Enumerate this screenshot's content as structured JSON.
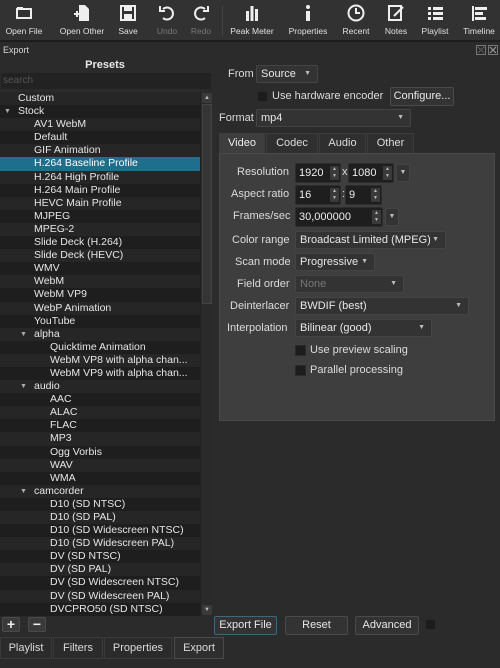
{
  "toolbar": {
    "buttons": [
      {
        "label": "Open File",
        "icon": "folder-icon"
      },
      {
        "label": "Open Other",
        "icon": "open-other-icon"
      },
      {
        "label": "Save",
        "icon": "save-icon"
      },
      {
        "label": "Undo",
        "icon": "undo-icon",
        "disabled": true
      },
      {
        "label": "Redo",
        "icon": "redo-icon",
        "disabled": true
      },
      {
        "label": "Peak Meter",
        "icon": "peak-meter-icon"
      },
      {
        "label": "Properties",
        "icon": "info-icon"
      },
      {
        "label": "Recent",
        "icon": "clock-icon"
      },
      {
        "label": "Notes",
        "icon": "notes-icon"
      },
      {
        "label": "Playlist",
        "icon": "list-icon"
      },
      {
        "label": "Timeline",
        "icon": "timeline-icon"
      }
    ]
  },
  "dock": {
    "title": "Export"
  },
  "presets": {
    "title": "Presets",
    "search_placeholder": "search",
    "items": [
      {
        "label": "Custom",
        "level": 0
      },
      {
        "label": "Stock",
        "level": 0,
        "expanded": true
      },
      {
        "label": "AV1 WebM",
        "level": 1
      },
      {
        "label": "Default",
        "level": 1
      },
      {
        "label": "GIF Animation",
        "level": 1
      },
      {
        "label": "H.264 Baseline Profile",
        "level": 1,
        "selected": true
      },
      {
        "label": "H.264 High Profile",
        "level": 1
      },
      {
        "label": "H.264 Main Profile",
        "level": 1
      },
      {
        "label": "HEVC Main Profile",
        "level": 1
      },
      {
        "label": "MJPEG",
        "level": 1
      },
      {
        "label": "MPEG-2",
        "level": 1
      },
      {
        "label": "Slide Deck (H.264)",
        "level": 1
      },
      {
        "label": "Slide Deck (HEVC)",
        "level": 1
      },
      {
        "label": "WMV",
        "level": 1
      },
      {
        "label": "WebM",
        "level": 1
      },
      {
        "label": "WebM VP9",
        "level": 1
      },
      {
        "label": "WebP Animation",
        "level": 1
      },
      {
        "label": "YouTube",
        "level": 1
      },
      {
        "label": "alpha",
        "level": 1,
        "expanded": true
      },
      {
        "label": "Quicktime Animation",
        "level": 2
      },
      {
        "label": "WebM VP8 with alpha chan...",
        "level": 2
      },
      {
        "label": "WebM VP9 with alpha chan...",
        "level": 2
      },
      {
        "label": "audio",
        "level": 1,
        "expanded": true
      },
      {
        "label": "AAC",
        "level": 2
      },
      {
        "label": "ALAC",
        "level": 2
      },
      {
        "label": "FLAC",
        "level": 2
      },
      {
        "label": "MP3",
        "level": 2
      },
      {
        "label": "Ogg Vorbis",
        "level": 2
      },
      {
        "label": "WAV",
        "level": 2
      },
      {
        "label": "WMA",
        "level": 2
      },
      {
        "label": "camcorder",
        "level": 1,
        "expanded": true
      },
      {
        "label": "D10 (SD NTSC)",
        "level": 2
      },
      {
        "label": "D10 (SD PAL)",
        "level": 2
      },
      {
        "label": "D10 (SD Widescreen NTSC)",
        "level": 2
      },
      {
        "label": "D10 (SD Widescreen PAL)",
        "level": 2
      },
      {
        "label": "DV (SD NTSC)",
        "level": 2
      },
      {
        "label": "DV (SD PAL)",
        "level": 2
      },
      {
        "label": "DV (SD Widescreen NTSC)",
        "level": 2
      },
      {
        "label": "DV (SD Widescreen PAL)",
        "level": 2
      },
      {
        "label": "DVCPRO50 (SD NTSC)",
        "level": 2
      }
    ],
    "add_label": "+",
    "remove_label": "−"
  },
  "form": {
    "from_label": "From",
    "from_value": "Source",
    "hw_encoder_label": "Use hardware encoder",
    "configure_label": "Configure...",
    "format_label": "Format",
    "format_value": "mp4",
    "tabs": [
      "Video",
      "Codec",
      "Audio",
      "Other"
    ],
    "active_tab": "Video",
    "resolution_label": "Resolution",
    "res_width": "1920",
    "res_x": "x",
    "res_height": "1080",
    "aspect_label": "Aspect ratio",
    "aspect_w": "16",
    "aspect_sep": ":",
    "aspect_h": "9",
    "fps_label": "Frames/sec",
    "fps_value": "30,000000",
    "color_range_label": "Color range",
    "color_range_value": "Broadcast Limited (MPEG)",
    "scan_mode_label": "Scan mode",
    "scan_mode_value": "Progressive",
    "field_order_label": "Field order",
    "field_order_value": "None",
    "deinterlacer_label": "Deinterlacer",
    "deinterlacer_value": "BWDIF (best)",
    "interpolation_label": "Interpolation",
    "interpolation_value": "Bilinear (good)",
    "preview_scaling_label": "Use preview scaling",
    "parallel_label": "Parallel processing"
  },
  "actions": {
    "export_file": "Export File",
    "reset": "Reset",
    "advanced": "Advanced"
  },
  "bottom_tabs": [
    "Playlist",
    "Filters",
    "Properties",
    "Export"
  ],
  "colors": {
    "selection": "#1e6e8c",
    "background": "#2b2b2b"
  }
}
